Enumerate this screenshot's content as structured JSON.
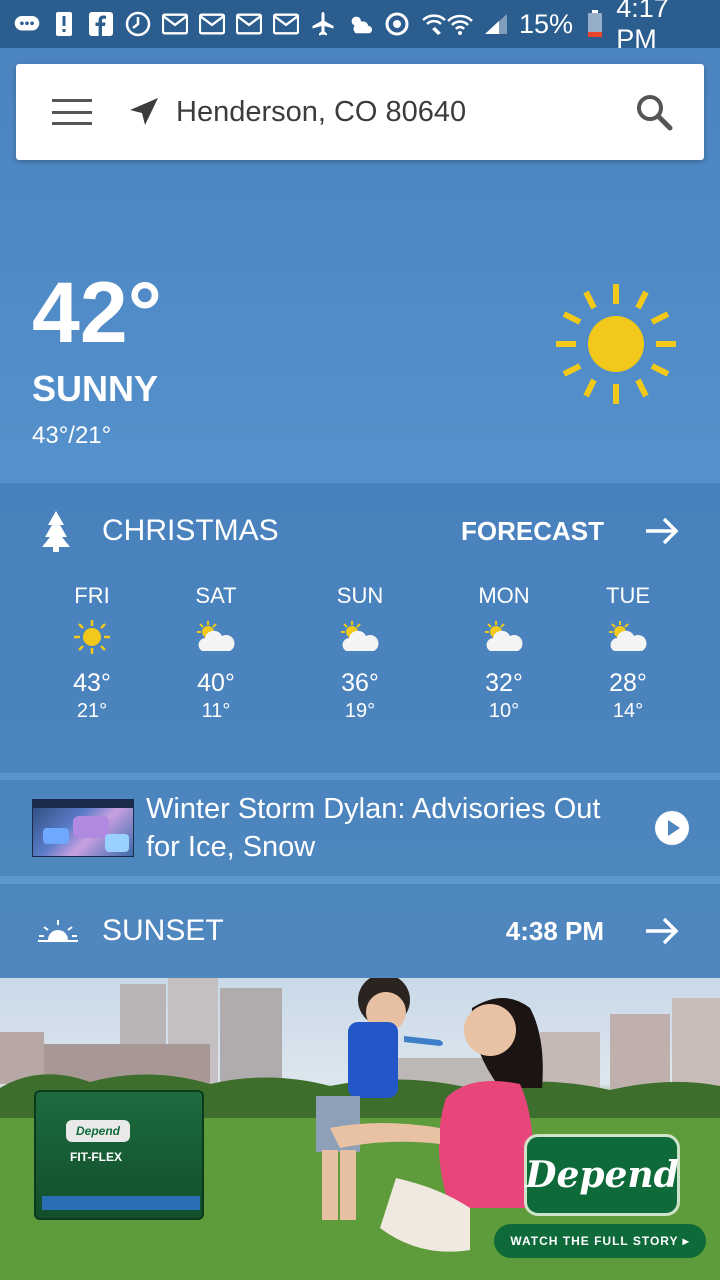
{
  "status_bar": {
    "battery": "15%",
    "time": "4:17 PM"
  },
  "search": {
    "location": "Henderson, CO 80640"
  },
  "current": {
    "temperature": "42°",
    "condition": "SUNNY",
    "hi_lo": "43°/21°",
    "icon": "sun-icon"
  },
  "forecast": {
    "title": "CHRISTMAS",
    "link": "FORECAST",
    "days": [
      {
        "name": "FRI",
        "icon": "sun-icon",
        "hi": "43°",
        "lo": "21°"
      },
      {
        "name": "SAT",
        "icon": "partly-cloudy-icon",
        "hi": "40°",
        "lo": "11°"
      },
      {
        "name": "SUN",
        "icon": "partly-cloudy-icon",
        "hi": "36°",
        "lo": "19°"
      },
      {
        "name": "MON",
        "icon": "partly-cloudy-icon",
        "hi": "32°",
        "lo": "10°"
      },
      {
        "name": "TUE",
        "icon": "partly-cloudy-icon",
        "hi": "28°",
        "lo": "14°"
      }
    ]
  },
  "news": {
    "title": "Winter Storm Dylan: Advisories Out for Ice, Snow"
  },
  "sunset": {
    "label": "SUNSET",
    "time": "4:38 PM"
  },
  "ad": {
    "brand": "Depend",
    "cta": "WATCH THE FULL STORY ▸",
    "product": "FIT-FLEX"
  },
  "colors": {
    "statusbar": "#2c5d8f",
    "sun": "#f2c81a",
    "ad_green": "#0f6a3a"
  }
}
